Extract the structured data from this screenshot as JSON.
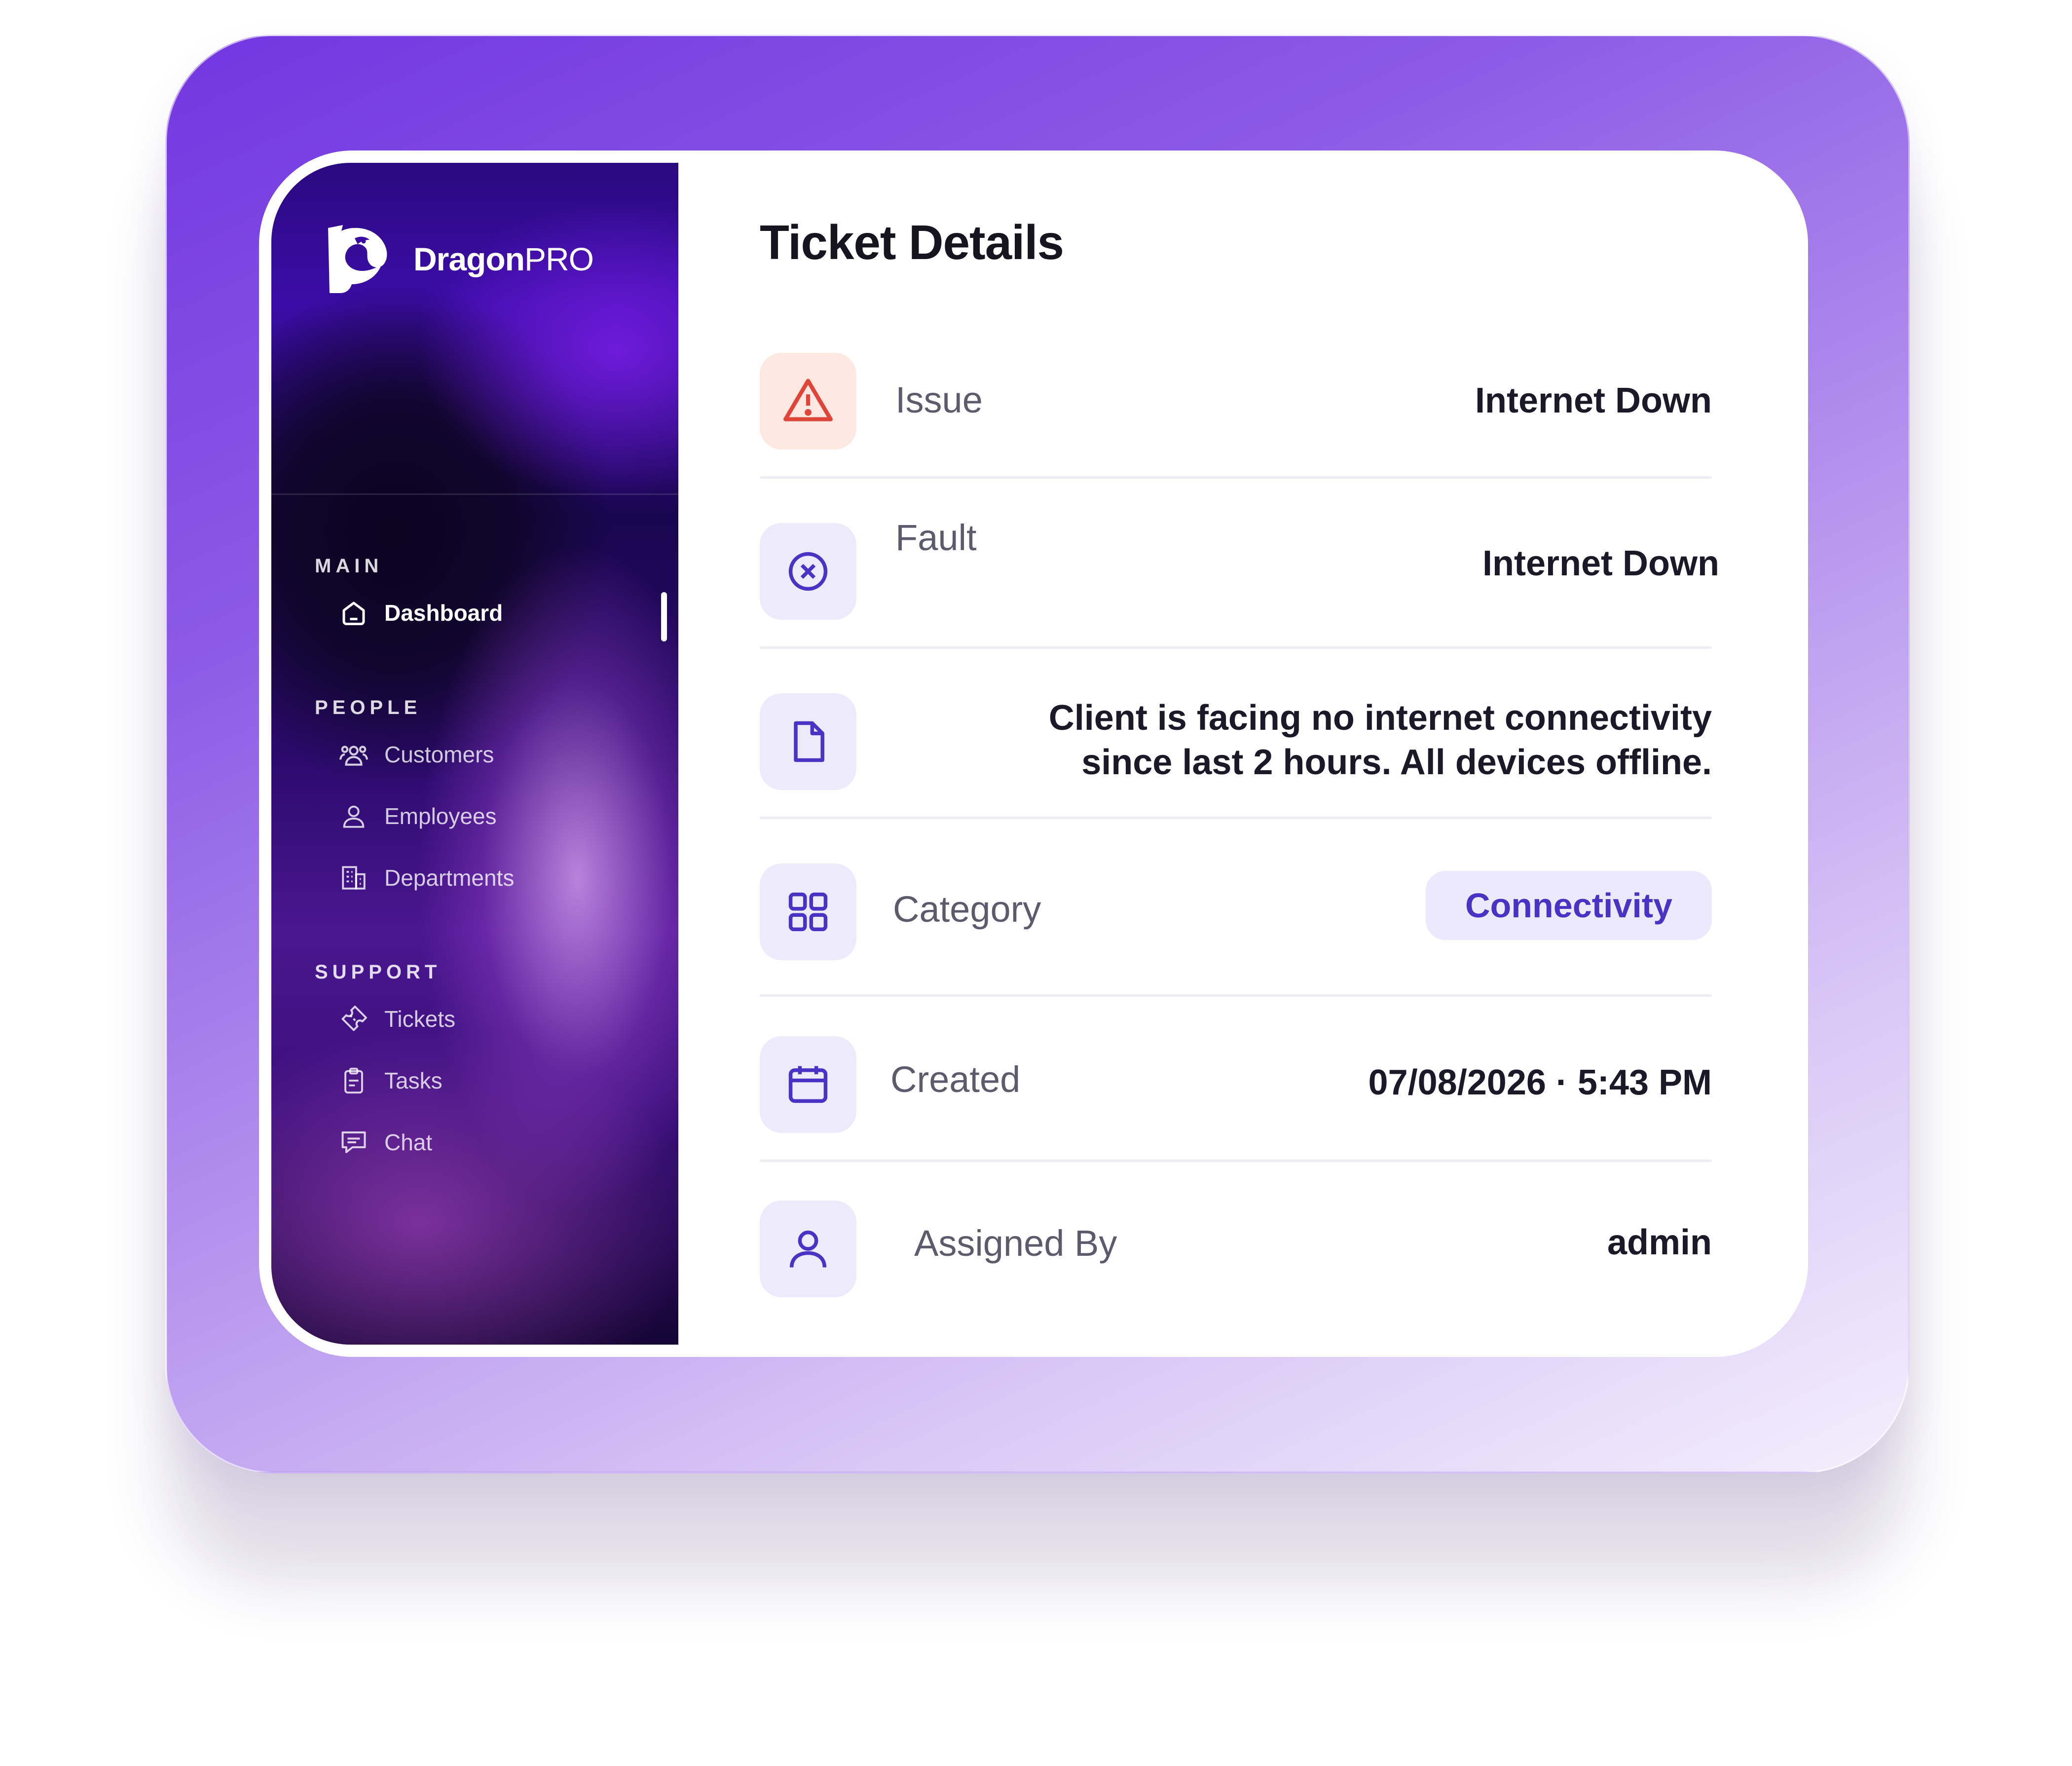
{
  "app": {
    "brand_bold": "Dragon",
    "brand_light": "PRO"
  },
  "sidebar": {
    "sections": [
      {
        "title": "MAIN",
        "items": [
          {
            "label": "Dashboard",
            "icon": "home-icon",
            "active": true
          }
        ]
      },
      {
        "title": "PEOPLE",
        "items": [
          {
            "label": "Customers",
            "icon": "users-icon"
          },
          {
            "label": "Employees",
            "icon": "user-icon"
          },
          {
            "label": "Departments",
            "icon": "building-icon"
          }
        ]
      },
      {
        "title": "SUPPORT",
        "items": [
          {
            "label": "Tickets",
            "icon": "ticket-icon"
          },
          {
            "label": "Tasks",
            "icon": "clipboard-icon"
          },
          {
            "label": "Chat",
            "icon": "chat-icon"
          }
        ]
      }
    ]
  },
  "ticket": {
    "title": "Ticket Details",
    "issue": {
      "label": "Issue",
      "value": "Internet Down",
      "icon": "warning-icon"
    },
    "fault": {
      "label": "Fault",
      "value": "Internet Down",
      "icon": "x-circle-icon"
    },
    "description": {
      "icon": "document-icon",
      "line1": "Client is facing no internet connectivity",
      "line2": "since last 2 hours. All devices offline."
    },
    "category": {
      "label": "Category",
      "value": "Connectivity",
      "icon": "grid-icon"
    },
    "created": {
      "label": "Created",
      "value": "07/08/2026 · 5:43 PM",
      "icon": "calendar-icon"
    },
    "assigned_by": {
      "label": "Assigned By",
      "value": "admin",
      "icon": "user-icon"
    }
  },
  "colors": {
    "accent": "#4a33c4",
    "warning": "#e0453a",
    "icon_bg": "#eceafb",
    "warning_bg": "#fde9e2"
  }
}
